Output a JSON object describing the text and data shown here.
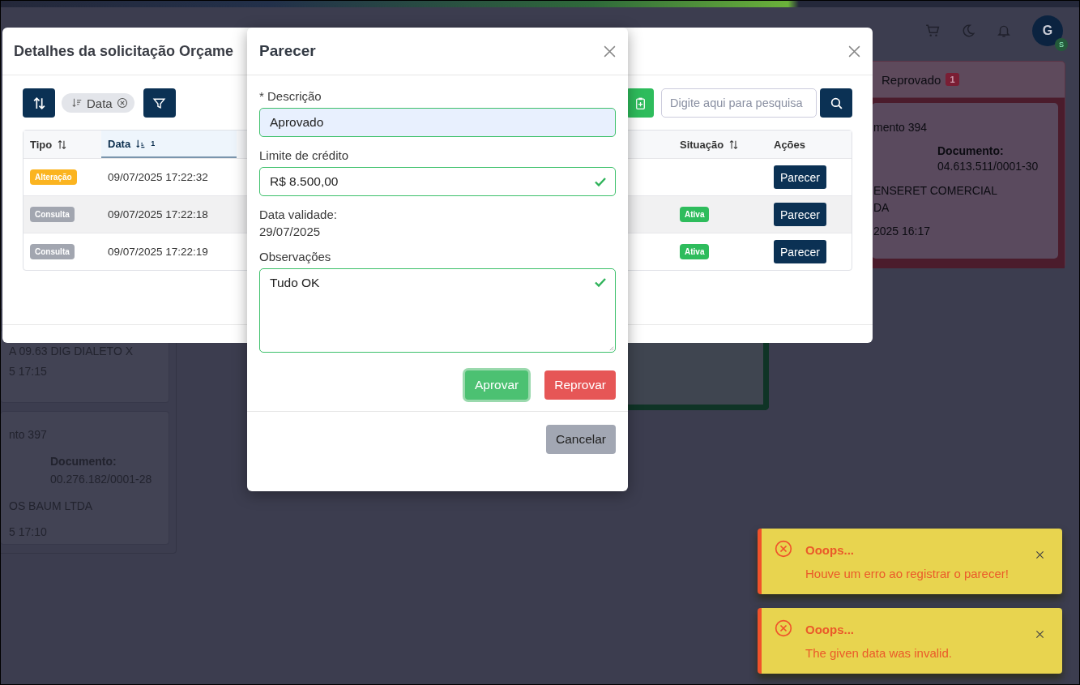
{
  "header": {
    "avatar": "G",
    "avatar_badge": "S"
  },
  "board": {
    "left_cards": [
      {
        "name": [
          "A 09.63 DIG DIALETO X"
        ],
        "date": "5 17:15"
      },
      {
        "title": "nto 397",
        "document_label": "Documento:",
        "document": "00.276.182/0001-28",
        "name": [
          "OS BAUM LTDA"
        ],
        "date": "5 17:10"
      }
    ],
    "right_column": {
      "title": "Reprovado",
      "count": "1",
      "card": {
        "title": "mento 394",
        "document_label": "Documento:",
        "document": "04.613.511/0001-30",
        "name": [
          "ENSERET COMERCIAL",
          "DA"
        ],
        "date": "2025 16:17"
      }
    }
  },
  "details_modal": {
    "title": "Detalhes da solicitação Orçame",
    "sort_chip": "Data",
    "search": {
      "placeholder": "Digite aqui para pesquisa"
    },
    "columns": [
      {
        "label": "Tipo",
        "sorted": false
      },
      {
        "label": "Data",
        "sorted": true,
        "sort_order": "1"
      },
      {
        "label": "Situação",
        "sorted": false
      },
      {
        "label": "Ações"
      }
    ],
    "rows": [
      {
        "tipo": "Alteração",
        "kind": "warning",
        "data": "09/07/2025 17:22:32",
        "highlighted": false,
        "action": "Parecer"
      },
      {
        "tipo": "Consulta",
        "kind": "muted",
        "data": "09/07/2025 17:22:18",
        "situacao": "Ativa",
        "highlighted": true,
        "action": "Parecer"
      },
      {
        "tipo": "Consulta",
        "kind": "muted",
        "data": "09/07/2025 17:22:19",
        "situacao": "Ativa",
        "highlighted": false,
        "action": "Parecer"
      }
    ]
  },
  "parecer_modal": {
    "title": "Parecer",
    "fields": [
      {
        "kind": "input",
        "label": "* Descrição",
        "value": "Aprovado",
        "valid": true,
        "autofilled": true
      },
      {
        "kind": "input",
        "label": "Limite de crédito",
        "value": "R$ 8.500,00",
        "valid": true,
        "autofilled": false
      },
      {
        "kind": "static",
        "label": "Data validade:",
        "value": "29/07/2025"
      },
      {
        "kind": "textarea",
        "label": "Observações",
        "value": "Tudo OK",
        "valid": true,
        "autofilled": false
      }
    ],
    "actions": [
      {
        "label": "Aprovar",
        "kind": "success",
        "focused": true
      },
      {
        "label": "Reprovar",
        "kind": "danger",
        "focused": false
      }
    ],
    "cancel": "Cancelar"
  },
  "toasts": [
    {
      "kind": "error",
      "title": "Ooops...",
      "message": "Houve um erro ao registrar o parecer!"
    },
    {
      "kind": "error",
      "title": "Ooops...",
      "message": "The given data was invalid."
    }
  ]
}
